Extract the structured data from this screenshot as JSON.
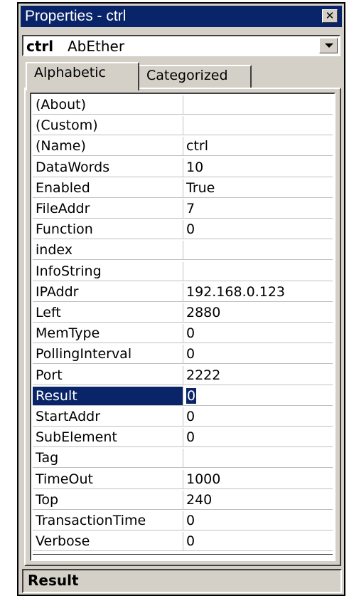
{
  "window": {
    "title": "Properties - ctrl",
    "close_icon": "close-icon"
  },
  "object_selector": {
    "name": "ctrl",
    "type": "AbEther",
    "dropdown_icon": "chevron-down-icon"
  },
  "tabs": [
    {
      "label": "Alphabetic",
      "active": true
    },
    {
      "label": "Categorized",
      "active": false
    }
  ],
  "properties": [
    {
      "name": "(About)",
      "value": ""
    },
    {
      "name": "(Custom)",
      "value": ""
    },
    {
      "name": "(Name)",
      "value": "ctrl"
    },
    {
      "name": "DataWords",
      "value": "10"
    },
    {
      "name": "Enabled",
      "value": "True"
    },
    {
      "name": "FileAddr",
      "value": "7"
    },
    {
      "name": "Function",
      "value": "0"
    },
    {
      "name": "index",
      "value": ""
    },
    {
      "name": "InfoString",
      "value": ""
    },
    {
      "name": "IPAddr",
      "value": "192.168.0.123"
    },
    {
      "name": "Left",
      "value": "2880"
    },
    {
      "name": "MemType",
      "value": "0"
    },
    {
      "name": "PollingInterval",
      "value": "0"
    },
    {
      "name": "Port",
      "value": "2222"
    },
    {
      "name": "Result",
      "value": "0",
      "selected": true
    },
    {
      "name": "StartAddr",
      "value": "0"
    },
    {
      "name": "SubElement",
      "value": "0"
    },
    {
      "name": "Tag",
      "value": ""
    },
    {
      "name": "TimeOut",
      "value": "1000"
    },
    {
      "name": "Top",
      "value": "240"
    },
    {
      "name": "TransactionTime",
      "value": "0"
    },
    {
      "name": "Verbose",
      "value": "0"
    }
  ],
  "description": {
    "title": "Result"
  },
  "colors": {
    "titlebar": "#0a246a",
    "face": "#d4d0c8",
    "selection": "#0a246a"
  }
}
